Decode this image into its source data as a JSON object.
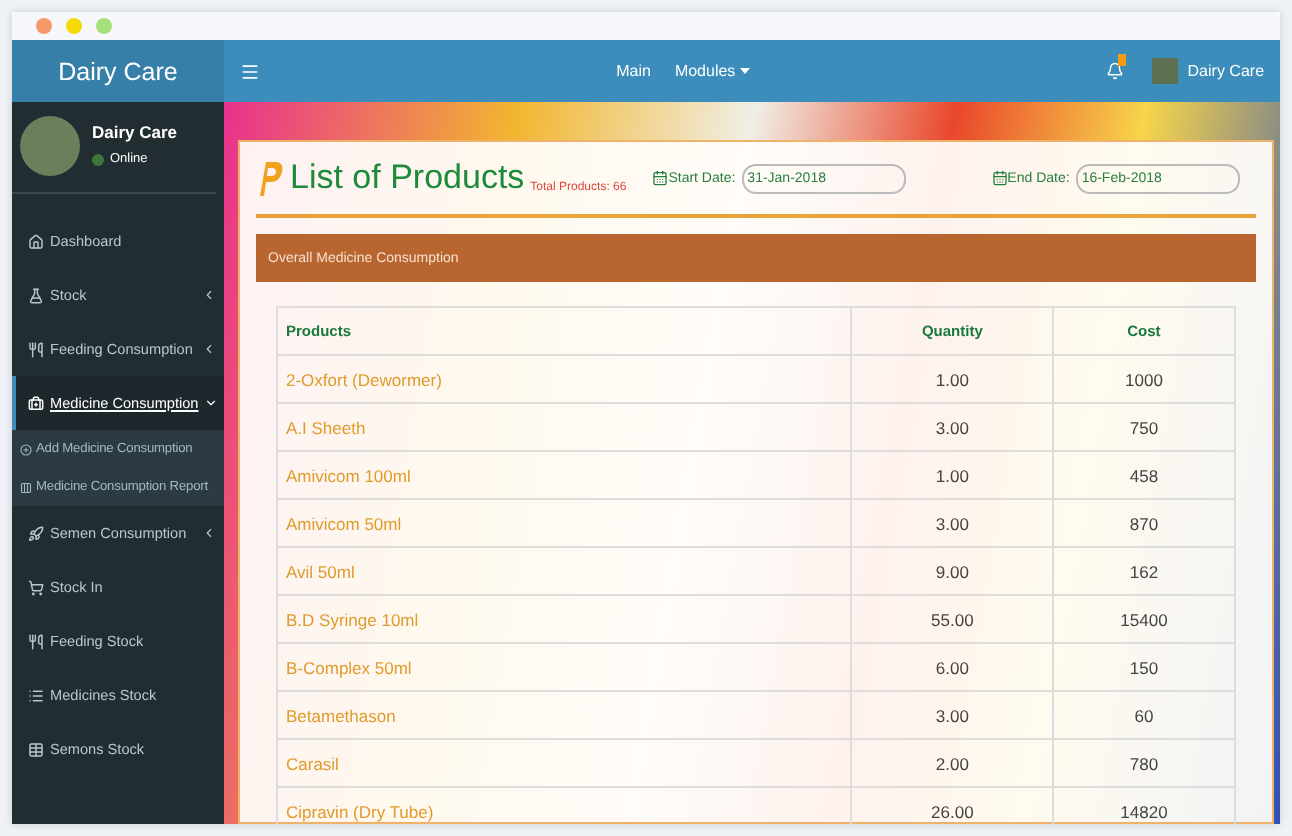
{
  "window": {
    "controls": [
      {
        "color": "#f79a6b"
      },
      {
        "color": "#f5d90a"
      },
      {
        "color": "#a6e07a"
      }
    ]
  },
  "header": {
    "brand": "Dairy Care",
    "nav": [
      {
        "label": "Main",
        "dropdown": false
      },
      {
        "label": "Modules",
        "dropdown": true
      }
    ],
    "user": "Dairy Care"
  },
  "sidebar": {
    "user": {
      "name": "Dairy Care",
      "status": "Online"
    },
    "items": [
      {
        "label": "Dashboard",
        "selected": false
      },
      {
        "label": "Stock",
        "selected": false,
        "expanded": false
      },
      {
        "label": "Feeding Consumption",
        "selected": false,
        "expanded": false
      },
      {
        "label": "Medicine Consumption",
        "selected": true,
        "expanded": true,
        "children": [
          {
            "label": "Add Medicine Consumption"
          },
          {
            "label": "Medicine Consumption Report"
          }
        ]
      },
      {
        "label": "Semen Consumption",
        "selected": false,
        "expanded": false
      },
      {
        "label": "Stock In",
        "selected": false
      },
      {
        "label": "Feeding Stock",
        "selected": false
      },
      {
        "label": "Medicines Stock",
        "selected": false
      },
      {
        "label": "Semons Stock",
        "selected": false
      }
    ]
  },
  "card": {
    "title": "List of Products",
    "total": "Total Products: 66",
    "start_label": "Start Date:",
    "start_value": "31-Jan-2018",
    "end_label": "End Date:",
    "end_value": "16-Feb-2018",
    "panel_title": "Overall Medicine Consumption",
    "table": {
      "columns": [
        "Products",
        "Quantity",
        "Cost"
      ],
      "rows": [
        [
          "2-Oxfort (Dewormer)",
          "1.00",
          "1000"
        ],
        [
          "A.I Sheeth",
          "3.00",
          "750"
        ],
        [
          "Amivicom 100ml",
          "1.00",
          "458"
        ],
        [
          "Amivicom 50ml",
          "3.00",
          "870"
        ],
        [
          "Avil 50ml",
          "9.00",
          "162"
        ],
        [
          "B.D Syringe 10ml",
          "55.00",
          "15400"
        ],
        [
          "B-Complex 50ml",
          "6.00",
          "150"
        ],
        [
          "Betamethason",
          "3.00",
          "60"
        ],
        [
          "Carasil",
          "2.00",
          "780"
        ],
        [
          "Cipravin (Dry Tube)",
          "26.00",
          "14820"
        ]
      ]
    }
  }
}
